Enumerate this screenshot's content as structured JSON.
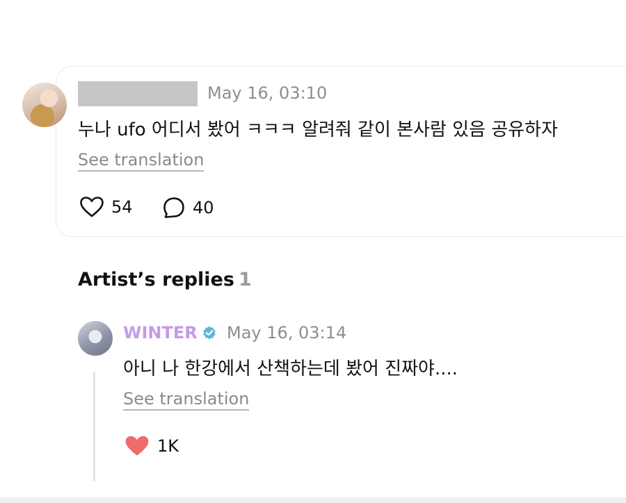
{
  "post": {
    "timestamp": "May 16, 03:10",
    "text": "누나 ufo 어디서 봤어 ㅋㅋㅋ 알려줘 같이 본사람 있음 공유하자",
    "see_translation": "See translation",
    "likes": "54",
    "comments": "40"
  },
  "replies_section": {
    "title": "Artist’s replies",
    "count": "1"
  },
  "reply": {
    "author": "WINTER",
    "timestamp": "May 16, 03:14",
    "text": "아니 나 한강에서 산책하는데 봤어 진짜야....",
    "see_translation": "See translation",
    "likes": "1K"
  },
  "colors": {
    "artist_name": "#c39ce6",
    "verified_badge": "#5bb8d6",
    "liked_heart": "#f06b6b",
    "muted_text": "#8e8e8e"
  },
  "icons": {
    "post_like": "heart-outline-icon",
    "post_comment": "speech-bubble-icon",
    "reply_like": "heart-filled-icon",
    "verified": "verified-badge-icon"
  }
}
